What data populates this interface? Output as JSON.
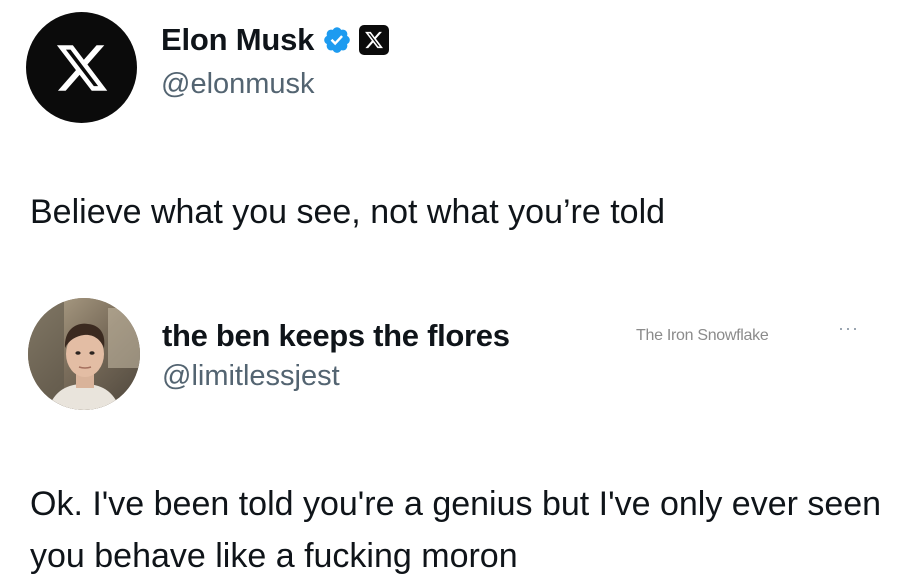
{
  "original_post": {
    "author": {
      "display_name": "Elon Musk",
      "handle": "@elonmusk",
      "avatar_icon": "x-logo-icon",
      "verified_icon": "verified-badge-icon",
      "affiliate_icon": "x-affiliate-badge-icon"
    },
    "text": "Believe what you see, not what you’re told"
  },
  "reply": {
    "author": {
      "display_name": "the ben keeps the flores",
      "handle": "@limitlessjest",
      "avatar_icon": "profile-photo"
    },
    "watermark": "The Iron Snowflake",
    "more_icon": "more-options-icon",
    "more_label": "···",
    "text": "Ok. I've been told you're a genius but I've only ever seen you behave like a fucking moron"
  },
  "colors": {
    "text": "#0f1419",
    "secondary_text": "#536471",
    "verified_blue": "#1d9bf0",
    "avatar_black": "#0b0b0b",
    "background": "#ffffff"
  }
}
